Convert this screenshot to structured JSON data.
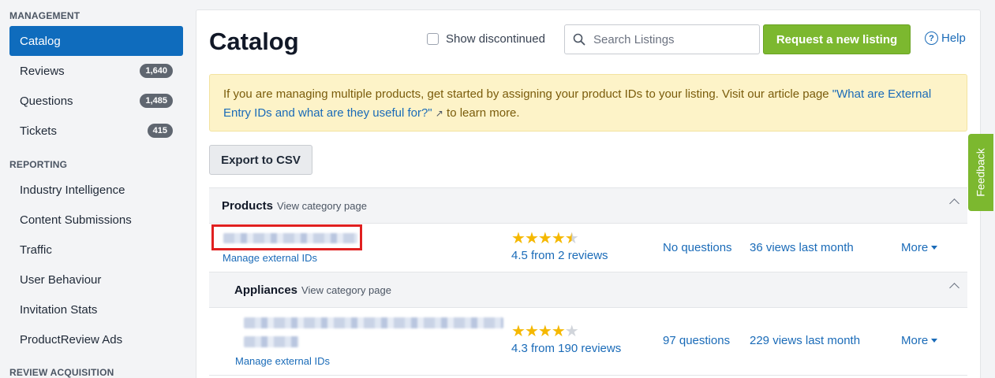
{
  "sidebar": {
    "sections": {
      "management": "MANAGEMENT",
      "reporting": "REPORTING",
      "review_acquisition": "REVIEW ACQUISITION"
    },
    "items": [
      {
        "label": "Catalog",
        "active": true
      },
      {
        "label": "Reviews",
        "badge": "1,640"
      },
      {
        "label": "Questions",
        "badge": "1,485"
      },
      {
        "label": "Tickets",
        "badge": "415"
      },
      {
        "label": "Industry Intelligence"
      },
      {
        "label": "Content Submissions"
      },
      {
        "label": "Traffic"
      },
      {
        "label": "User Behaviour"
      },
      {
        "label": "Invitation Stats"
      },
      {
        "label": "ProductReview Ads"
      }
    ]
  },
  "header": {
    "title": "Catalog",
    "show_discontinued": "Show discontinued",
    "search_placeholder": "Search Listings",
    "request_button": "Request a new listing",
    "help": "Help"
  },
  "alert": {
    "text": "If you are managing multiple products, get started by assigning your product IDs to your listing. Visit our article page ",
    "link": "\"What are External Entry IDs and what are they useful for?\"",
    "arrow": "↗",
    "tail": " to learn more."
  },
  "export_button": "Export to CSV",
  "groups": [
    {
      "name": "Products",
      "link": "View category page"
    },
    {
      "name": "Appliances",
      "link": "View category page"
    }
  ],
  "rows": [
    {
      "manage": "Manage external IDs",
      "rating": 4.5,
      "reviews": "4.5 from 2 reviews",
      "questions": "No questions",
      "views": "36 views last month",
      "more": "More"
    },
    {
      "manage": "Manage external IDs",
      "rating": 4.3,
      "reviews": "4.3 from 190 reviews",
      "questions": "97 questions",
      "views": "229 views last month",
      "more": "More"
    }
  ],
  "feedback": "Feedback",
  "colors": {
    "accent_blue": "#0f6cbd",
    "link_blue": "#1a6bb8",
    "green": "#7cb82f",
    "star": "#f5b800",
    "alert_bg": "#fdf3c8",
    "highlight": "#e02020"
  }
}
